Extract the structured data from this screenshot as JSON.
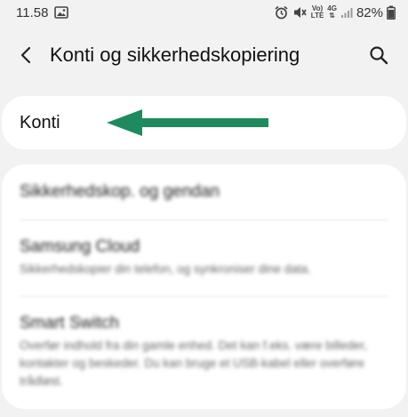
{
  "status_bar": {
    "time": "11.58",
    "volte_label": "Vo)",
    "lte_label": "LTE",
    "network_label": "4G",
    "battery": "82%"
  },
  "app_bar": {
    "title": "Konti og sikkerhedskopiering"
  },
  "konti_item": {
    "label": "Konti"
  },
  "arrow_color": "#1f8a5e",
  "list": {
    "items": [
      {
        "title": "Sikkerhedskop. og gendan",
        "subtitle": ""
      },
      {
        "title": "Samsung Cloud",
        "subtitle": "Sikkerhedskopier din telefon, og synkroniser dine data."
      },
      {
        "title": "Smart Switch",
        "subtitle": "Overfør indhold fra din gamle enhed. Det kan f.eks. være billeder, kontakter og beskeder. Du kan bruge et USB-kabel eller overføre trådløst."
      }
    ]
  }
}
